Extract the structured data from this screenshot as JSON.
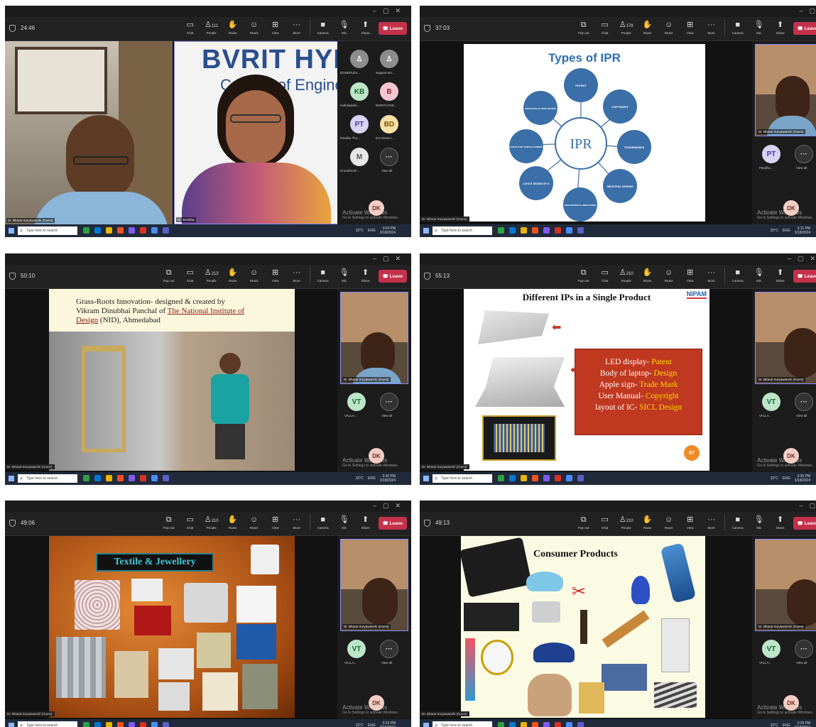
{
  "colors": {
    "leave": "#c4314b",
    "selfview_border": "#8a8ff5",
    "ipr_circle": "#3b6fa8",
    "slide_text_highlight": "#ffd700"
  },
  "toolbar": {
    "chat": "Chat",
    "people": "People",
    "raise": "Raise",
    "react": "React",
    "view": "View",
    "more": "More",
    "camera": "Camera",
    "mic": "Mic",
    "share": "Share",
    "leave": "Leave",
    "popout": "Pop out"
  },
  "taskbar": {
    "search": "Type here to search",
    "weather": "32°C",
    "lang": "ENG",
    "date": "3/18/2024"
  },
  "activate": {
    "line1": "Activate Windows",
    "line2": "Go to Settings to activate Windows."
  },
  "self_initials": "DK",
  "guest_name": "Dr. Bharat Suryawanshi (Guest)",
  "view_all": "View all",
  "shots": [
    {
      "timer": "24:46",
      "people_count": "111",
      "left_caption": "Dr. Bharat Suryawanshi (Guest)",
      "right_caption": "Dr. Sumitha",
      "banner": "BVRIT HYD",
      "banner2": "College of Engineering",
      "participants": [
        {
          "initials": "",
          "name": "DONEPUDI..."
        },
        {
          "initials": "",
          "name": "Support BV..."
        },
        {
          "initials": "KB",
          "name": "Kolli Balakri..."
        },
        {
          "initials": "B",
          "name": "BVRITHYDE..."
        },
        {
          "initials": "PT",
          "name": "Pandhu Tho..."
        },
        {
          "initials": "BD",
          "name": "B KANAKA ..."
        },
        {
          "initials": "M",
          "name": "M.santhosh..."
        },
        {
          "initials": "···",
          "name": "View all"
        }
      ],
      "clock": "3:04 PM"
    },
    {
      "timer": "37:03",
      "people_count": "178",
      "clock": "3:11 PM",
      "slide_title": "Types of IPR",
      "center": "IPR",
      "nodes": [
        "PATENT",
        "COPYRIGHT",
        "TRADEMARKS",
        "INDUSTRIAL DESIGNS",
        "GEOGRAPHICAL INDICATIONS",
        "LAYOUT DESIGN OF IC",
        "PROTECTION OF PLANT VARIETIES & FARMERS RIGHTS",
        "PROTECTION OF TRADE SECRETS"
      ],
      "rail_avatar": "PT",
      "rail_name": "Pandhu..."
    },
    {
      "timer": "50:10",
      "people_count": "213",
      "clock": "3:30 PM",
      "line1": "Grass-Roots Innovation- designed & created by",
      "line2a": "Vikram Dinubhai Panchal of ",
      "line2b": "The National Institute of",
      "line3a": "Design",
      "line3b": " (NID), Ahmedabad",
      "rail_avatar": "VT",
      "rail_name": "VALLA..."
    },
    {
      "timer": "55:13",
      "people_count": "210",
      "clock": "3:35 PM",
      "slide_title": "Different IPs in a Single Product",
      "logo": "NIPAM",
      "items": [
        {
          "label": "LED display- ",
          "value": "Patent"
        },
        {
          "label": "Body of laptop- ",
          "value": "Design"
        },
        {
          "label": "Apple sign- ",
          "value": "Trade Mark"
        },
        {
          "label": "User Manual- ",
          "value": "Copyright"
        },
        {
          "label": "layout of IC- ",
          "value": "SICL Design"
        }
      ],
      "page": "67",
      "rail_avatar": "VT",
      "rail_name": "VALLA..."
    },
    {
      "timer": "49:06",
      "people_count": "210",
      "clock": "3:29 PM",
      "slide_title": "Textile & Jewellery",
      "rail_avatar": "VT",
      "rail_name": "VALLA..."
    },
    {
      "timer": "49:13",
      "people_count": "210",
      "clock": "3:29 PM",
      "slide_title": "Consumer Products",
      "rail_avatar": "VT",
      "rail_name": "VALLA..."
    }
  ]
}
